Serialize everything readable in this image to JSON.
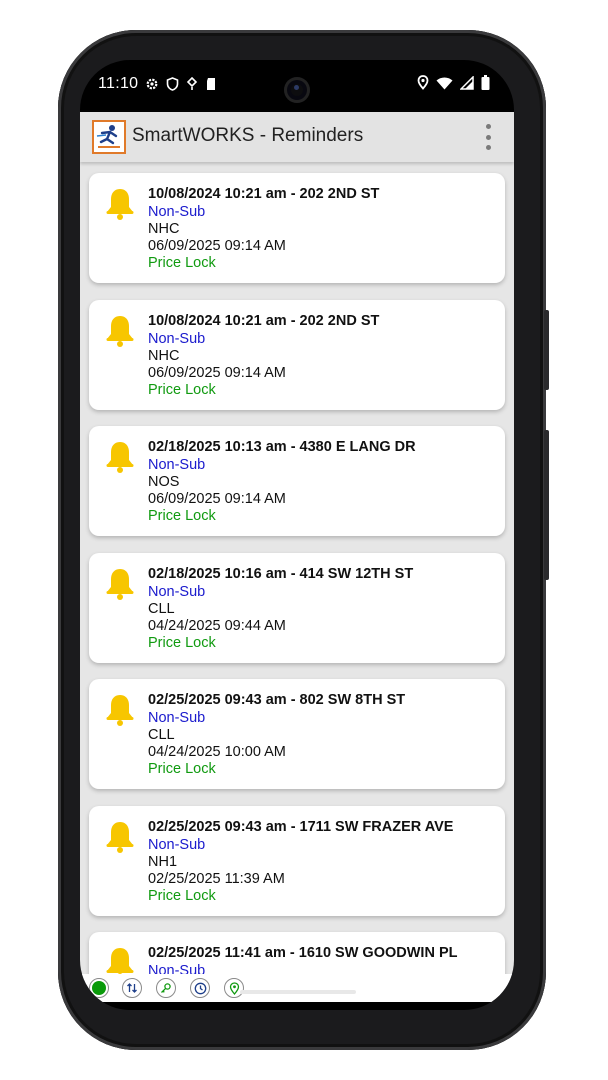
{
  "status_bar": {
    "time": "11:10"
  },
  "app": {
    "title": "SmartWORKS - Reminders"
  },
  "reminders": [
    {
      "title": "10/08/2024 10:21 am - 202 2ND ST",
      "type": "Non-Sub",
      "code": "NHC",
      "date": "06/09/2025 09:14 AM",
      "status": "Price Lock"
    },
    {
      "title": "10/08/2024 10:21 am - 202 2ND ST",
      "type": "Non-Sub",
      "code": "NHC",
      "date": "06/09/2025 09:14 AM",
      "status": "Price Lock"
    },
    {
      "title": "02/18/2025 10:13 am - 4380 E LANG DR",
      "type": "Non-Sub",
      "code": "NOS",
      "date": "06/09/2025 09:14 AM",
      "status": "Price Lock"
    },
    {
      "title": "02/18/2025 10:16 am - 414 SW 12TH ST",
      "type": "Non-Sub",
      "code": "CLL",
      "date": "04/24/2025 09:44 AM",
      "status": "Price Lock"
    },
    {
      "title": "02/25/2025 09:43 am - 802 SW 8TH ST",
      "type": "Non-Sub",
      "code": "CLL",
      "date": "04/24/2025 10:00 AM",
      "status": "Price Lock"
    },
    {
      "title": "02/25/2025 09:43 am - 1711 SW FRAZER AVE",
      "type": "Non-Sub",
      "code": "NH1",
      "date": "02/25/2025 11:39 AM",
      "status": "Price Lock"
    },
    {
      "title": "02/25/2025 11:41 am - 1610 SW GOODWIN PL",
      "type": "Non-Sub",
      "code": "",
      "date": "",
      "status": ""
    }
  ],
  "bottom_bar": {
    "icons": [
      "status-dot-icon",
      "sort-arrows-icon",
      "key-icon",
      "clock-icon",
      "location-pin-icon"
    ],
    "status_color": "#0a9a0a"
  },
  "colors": {
    "type_text": "#1a1acd",
    "status_text": "#109a10",
    "bell": "#f7c600"
  }
}
